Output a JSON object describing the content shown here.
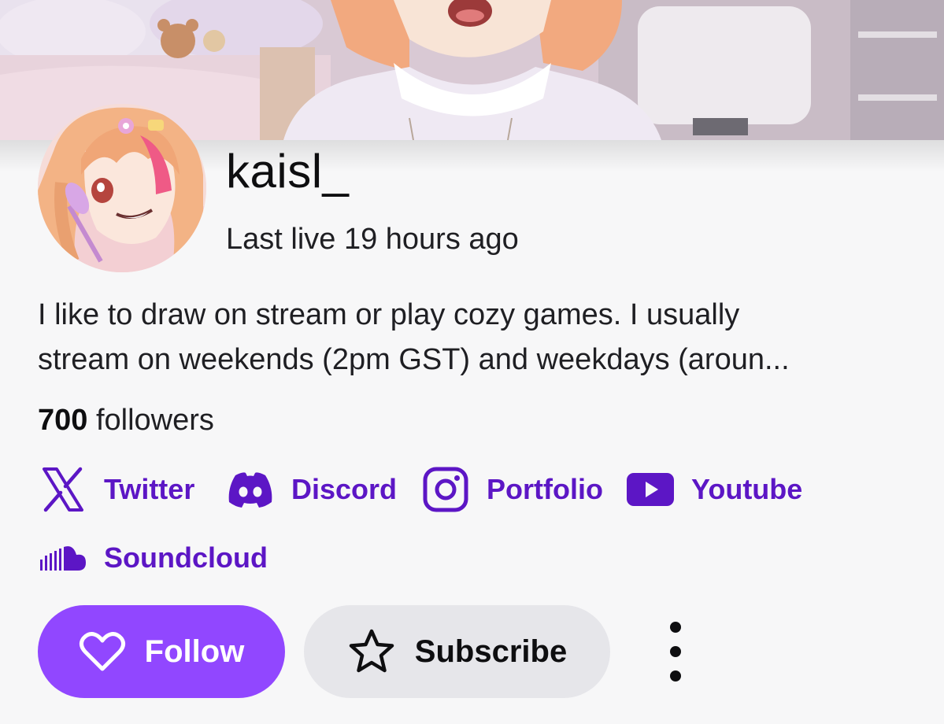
{
  "channel": {
    "name": "kaisl_",
    "last_live": "Last live 19 hours ago",
    "bio_lines": [
      "I like to draw on stream or play cozy games. I usually",
      "stream on weekends (2pm GST) and weekdays (aroun..."
    ],
    "followers_count": "700",
    "followers_label": "followers"
  },
  "socials": [
    {
      "label": "Twitter",
      "icon": "x-twitter-icon"
    },
    {
      "label": "Discord",
      "icon": "discord-icon"
    },
    {
      "label": "Portfolio",
      "icon": "instagram-icon"
    },
    {
      "label": "Youtube",
      "icon": "youtube-icon"
    },
    {
      "label": "Soundcloud",
      "icon": "soundcloud-icon"
    }
  ],
  "actions": {
    "follow_label": "Follow",
    "subscribe_label": "Subscribe",
    "more_icon": "more-vertical-icon"
  },
  "colors": {
    "accent": "#9147ff",
    "link": "#5c16c5",
    "page_background": "#f7f7f8",
    "subscribe_background": "#e6e6ea"
  }
}
